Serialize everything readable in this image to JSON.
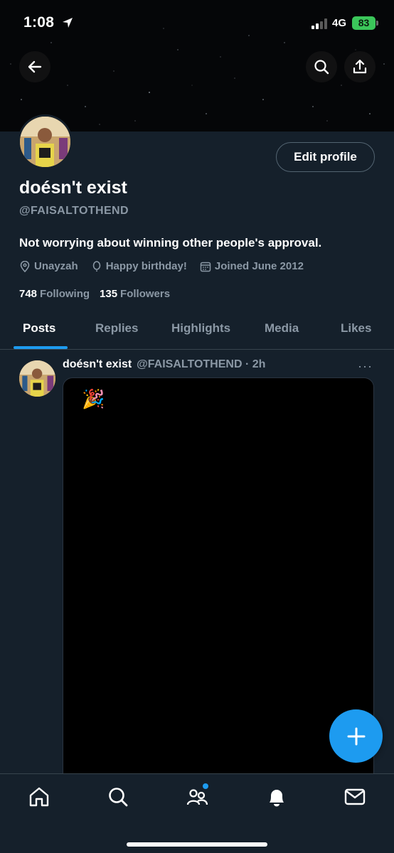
{
  "status_bar": {
    "time": "1:08",
    "network": "4G",
    "battery": "83"
  },
  "profile": {
    "display_name": "doésn't exist",
    "handle": "@FAISALTOTHEND",
    "bio": "Not worrying about winning other people's approval.",
    "location": "Unayzah",
    "birthday": "Happy birthday!",
    "joined": "Joined June 2012",
    "following_count": "748",
    "following_label": "Following",
    "followers_count": "135",
    "followers_label": "Followers",
    "edit_button": "Edit profile"
  },
  "tabs": [
    {
      "label": "Posts",
      "active": true
    },
    {
      "label": "Replies",
      "active": false
    },
    {
      "label": "Highlights",
      "active": false
    },
    {
      "label": "Media",
      "active": false
    },
    {
      "label": "Likes",
      "active": false
    }
  ],
  "post": {
    "author_name": "doésn't exist",
    "author_handle": "@FAISALTOTHEND · 2h",
    "more": "···",
    "emoji": "🎉"
  },
  "bottom_nav": [
    "home-icon",
    "search-icon",
    "communities-icon",
    "notifications-icon",
    "messages-icon"
  ],
  "colors": {
    "accent": "#1d9bf0",
    "background": "#15202b",
    "muted": "#8b98a5",
    "battery": "#3bc65a"
  }
}
